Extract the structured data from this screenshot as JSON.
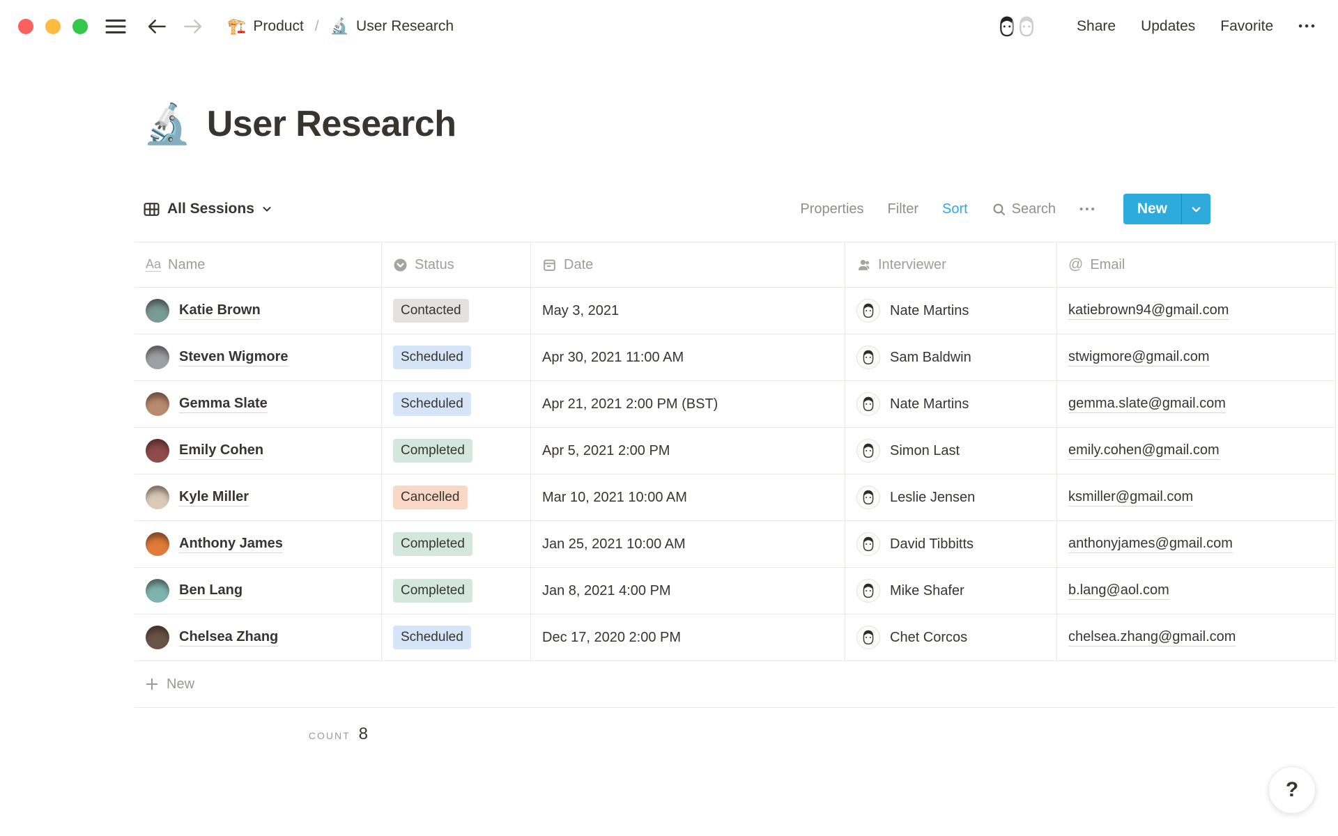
{
  "topbar": {
    "breadcrumb": {
      "parent_icon": "🏗️",
      "parent": "Product",
      "separator": "/",
      "page_icon": "🔬",
      "page": "User Research"
    },
    "share_label": "Share",
    "updates_label": "Updates",
    "favorite_label": "Favorite",
    "more_label": "•••"
  },
  "page": {
    "icon": "🔬",
    "title": "User Research"
  },
  "view_bar": {
    "view_name": "All Sessions",
    "properties_label": "Properties",
    "filter_label": "Filter",
    "sort_label": "Sort",
    "search_label": "Search",
    "more_label": "•••",
    "new_label": "New"
  },
  "table": {
    "columns": [
      {
        "label": "Name",
        "icon": "text",
        "icon_glyph": "Aa"
      },
      {
        "label": "Status",
        "icon": "select"
      },
      {
        "label": "Date",
        "icon": "calendar"
      },
      {
        "label": "Interviewer",
        "icon": "person"
      },
      {
        "label": "Email",
        "icon": "at",
        "icon_glyph": "@"
      }
    ],
    "rows": [
      {
        "name": "Katie Brown",
        "status": "Contacted",
        "status_color": "gray",
        "date": "May 3, 2021",
        "interviewer": "Nate Martins",
        "email": "katiebrown94@gmail.com",
        "avatar_color": "#7A9A94"
      },
      {
        "name": "Steven Wigmore",
        "status": "Scheduled",
        "status_color": "blue",
        "date": "Apr 30, 2021 11:00 AM",
        "interviewer": "Sam Baldwin",
        "email": "stwigmore@gmail.com",
        "avatar_color": "#9AA0A3"
      },
      {
        "name": "Gemma Slate",
        "status": "Scheduled",
        "status_color": "blue",
        "date": "Apr 21, 2021 2:00 PM (BST)",
        "interviewer": "Nate Martins",
        "email": "gemma.slate@gmail.com",
        "avatar_color": "#B98A6E"
      },
      {
        "name": "Emily Cohen",
        "status": "Completed",
        "status_color": "green",
        "date": "Apr 5, 2021 2:00 PM",
        "interviewer": "Simon Last",
        "email": "emily.cohen@gmail.com",
        "avatar_color": "#8F4A4A"
      },
      {
        "name": "Kyle Miller",
        "status": "Cancelled",
        "status_color": "red",
        "date": "Mar 10, 2021 10:00 AM",
        "interviewer": "Leslie Jensen",
        "email": "ksmiller@gmail.com",
        "avatar_color": "#D9C9B6"
      },
      {
        "name": "Anthony James",
        "status": "Completed",
        "status_color": "green",
        "date": "Jan 25, 2021 10:00 AM",
        "interviewer": "David Tibbitts",
        "email": "anthonyjames@gmail.com",
        "avatar_color": "#E07B39"
      },
      {
        "name": "Ben Lang",
        "status": "Completed",
        "status_color": "green",
        "date": "Jan 8, 2021 4:00 PM",
        "interviewer": "Mike Shafer",
        "email": "b.lang@aol.com",
        "avatar_color": "#7FB3B0"
      },
      {
        "name": "Chelsea Zhang",
        "status": "Scheduled",
        "status_color": "blue",
        "date": "Dec 17, 2020 2:00 PM",
        "interviewer": "Chet Corcos",
        "email": "chelsea.zhang@gmail.com",
        "avatar_color": "#6B5347"
      }
    ],
    "new_row_label": "New",
    "count_label": "COUNT",
    "count_value": "8"
  },
  "help_label": "?",
  "theme": {
    "accent": "#2EAADC",
    "badge_gray": "#E3E2E0",
    "badge_blue": "#D6E4F7",
    "badge_green": "#D4E7DD",
    "badge_red": "#FAD8C7"
  }
}
